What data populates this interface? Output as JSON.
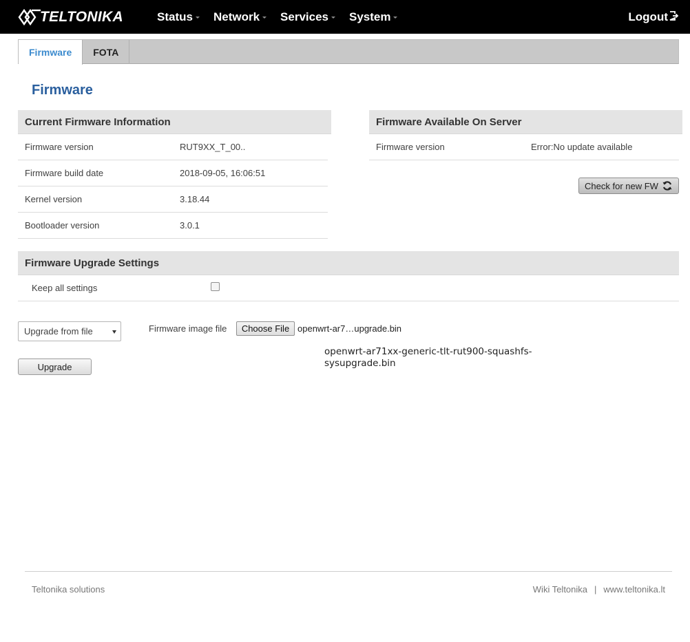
{
  "header": {
    "brand": "TELTONIKA",
    "nav": [
      {
        "label": "Status"
      },
      {
        "label": "Network"
      },
      {
        "label": "Services"
      },
      {
        "label": "System"
      }
    ],
    "logout_label": "Logout"
  },
  "tabs": [
    {
      "label": "Firmware",
      "active": true
    },
    {
      "label": "FOTA",
      "active": false
    }
  ],
  "page_title": "Firmware",
  "current_fw": {
    "title": "Current Firmware Information",
    "rows": [
      {
        "label": "Firmware version",
        "value": "RUT9XX_T_00.."
      },
      {
        "label": "Firmware build date",
        "value": "2018-09-05, 16:06:51"
      },
      {
        "label": "Kernel version",
        "value": "3.18.44"
      },
      {
        "label": "Bootloader version",
        "value": "3.0.1"
      }
    ]
  },
  "server_fw": {
    "title": "Firmware Available On Server",
    "rows": [
      {
        "label": "Firmware version",
        "value": "Error:No update available"
      }
    ],
    "check_button_label": "Check for new FW"
  },
  "upgrade_settings": {
    "title": "Firmware Upgrade Settings",
    "keep_settings_label": "Keep all settings",
    "keep_settings_checked": false
  },
  "upgrade": {
    "source_select_value": "Upgrade from file",
    "file_label": "Firmware image file",
    "choose_file_label": "Choose File",
    "file_name_short": "openwrt-ar7…upgrade.bin",
    "file_name_full": "openwrt-ar71xx-generic-tlt-rut900-squashfs-sysupgrade.bin",
    "upgrade_button_label": "Upgrade"
  },
  "footer": {
    "left": "Teltonika solutions",
    "links": [
      {
        "label": "Wiki Teltonika"
      },
      {
        "label": "www.teltonika.lt"
      }
    ],
    "separator": "|"
  },
  "colors": {
    "topbar": "#000000",
    "accent": "#3c8bce",
    "title": "#2a5f9e"
  }
}
